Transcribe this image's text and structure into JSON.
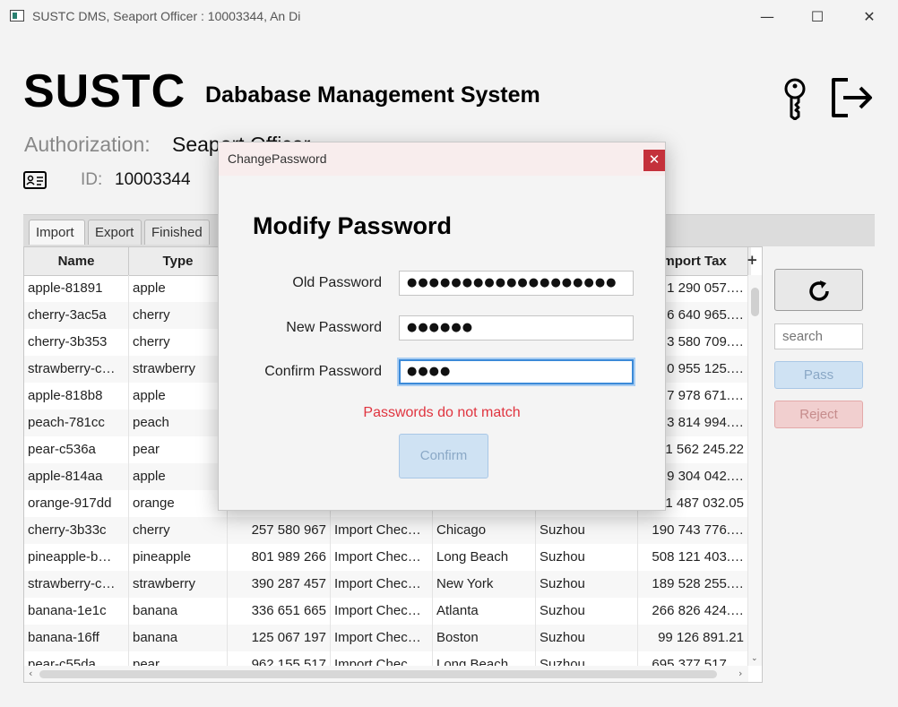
{
  "window": {
    "title": "SUSTC DMS, Seaport Officer : 10003344, An Di",
    "min_glyph": "—",
    "max_glyph": "☐",
    "close_glyph": "✕"
  },
  "header": {
    "title": "SUSTC",
    "subtitle": "Dababase Management System",
    "auth_label": "Authorization:",
    "auth_value": "Seaport Officer",
    "id_label": "ID:",
    "id_value": "10003344"
  },
  "tabs": [
    {
      "label": "Import"
    },
    {
      "label": "Export"
    },
    {
      "label": "Finished"
    }
  ],
  "table": {
    "columns": [
      "Name",
      "Type",
      "",
      "",
      "",
      "",
      "Import Tax"
    ],
    "rows": [
      [
        "apple-81891",
        "apple",
        "",
        "",
        "",
        "",
        "1 290 057.…"
      ],
      [
        "cherry-3ac5a",
        "cherry",
        "",
        "",
        "",
        "",
        "6 640 965.…"
      ],
      [
        "cherry-3b353",
        "cherry",
        "",
        "",
        "",
        "",
        "3 580 709.…"
      ],
      [
        "strawberry-c…",
        "strawberry",
        "",
        "",
        "",
        "",
        "0 955 125.…"
      ],
      [
        "apple-818b8",
        "apple",
        "",
        "",
        "",
        "",
        "7 978 671.…"
      ],
      [
        "peach-781cc",
        "peach",
        "",
        "",
        "",
        "",
        "3 814 994.…"
      ],
      [
        "pear-c536a",
        "pear",
        "",
        "",
        "",
        "",
        "1 562 245.22"
      ],
      [
        "apple-814aa",
        "apple",
        "",
        "",
        "",
        "",
        "9 304 042.…"
      ],
      [
        "orange-917dd",
        "orange",
        "",
        "",
        "",
        "",
        "1 487 032.05"
      ],
      [
        "cherry-3b33c",
        "cherry",
        "257 580 967",
        "Import Chec…",
        "Chicago",
        "Suzhou",
        "190 743 776.…"
      ],
      [
        "pineapple-b…",
        "pineapple",
        "801 989 266",
        "Import Chec…",
        "Long Beach",
        "Suzhou",
        "508 121 403.…"
      ],
      [
        "strawberry-c…",
        "strawberry",
        "390 287 457",
        "Import Chec…",
        "New York",
        "Suzhou",
        "189 528 255.…"
      ],
      [
        "banana-1e1c",
        "banana",
        "336 651 665",
        "Import Chec…",
        "Atlanta",
        "Suzhou",
        "266 826 424.…"
      ],
      [
        "banana-16ff",
        "banana",
        "125 067 197",
        "Import Chec…",
        "Boston",
        "Suzhou",
        "99 126 891.21"
      ],
      [
        "pear-c55da",
        "pear",
        "962 155 517",
        "Import Chec…",
        "Long Beach",
        "Suzhou",
        "695 377 517.…"
      ]
    ],
    "plus_glyph": "+"
  },
  "side": {
    "search_placeholder": "search",
    "pass_label": "Pass",
    "reject_label": "Reject"
  },
  "dialog": {
    "title": "ChangePassword",
    "close_glyph": "✕",
    "heading": "Modify Password",
    "old_label": "Old Password",
    "old_value": "●●●●●●●●●●●●●●●●●●●",
    "new_label": "New Password",
    "new_value": "●●●●●●",
    "confirm_label": "Confirm Password",
    "confirm_value": "●●●●",
    "error": "Passwords do not match",
    "confirm_button": "Confirm"
  },
  "colors": {
    "error": "#e0343f",
    "focus": "#3b8ad8",
    "close": "#c4313b"
  }
}
